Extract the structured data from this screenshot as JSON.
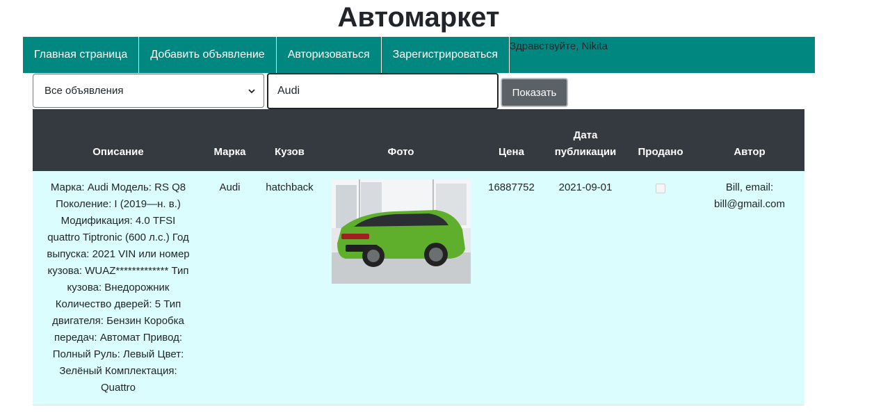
{
  "header": {
    "title": "Автомаркет"
  },
  "nav": {
    "items": [
      {
        "label": "Главная страница"
      },
      {
        "label": "Добавить объявление"
      },
      {
        "label": "Авторизоваться"
      },
      {
        "label": "Зарегистрироваться"
      }
    ],
    "greeting": "Здравствуйте, Nikita"
  },
  "filters": {
    "select_value": "Все объявления",
    "search_value": "Audi",
    "show_button": "Показать"
  },
  "table": {
    "headers": [
      "Описание",
      "Марка",
      "Кузов",
      "Фото",
      "Цена",
      "Дата публикации",
      "Продано",
      "Автор"
    ],
    "rows": [
      {
        "description": "Марка: Audi Модель: RS Q8 Поколение: I (2019—н. в.) Модификация: 4.0 TFSI quattro Tiptronic (600 л.с.) Год выпуска: 2021 VIN или номер кузова: WUAZ************* Тип кузова: Внедорожник Количество дверей: 5 Тип двигателя: Бензин Коробка передач: Автомат Привод: Полный Руль: Левый Цвет: Зелёный Комплектация: Quattro",
        "brand": "Audi",
        "body": "hatchback",
        "photo": "green-audi-rs-q8-photo",
        "price": "16887752",
        "date": "2021-09-01",
        "sold": false,
        "author": "Bill, email: bill@gmail.com"
      }
    ]
  },
  "colors": {
    "navbar": "#00877f",
    "table_header": "#343a40",
    "row_bg": "#dbfdfd",
    "button": "#5a6268"
  }
}
